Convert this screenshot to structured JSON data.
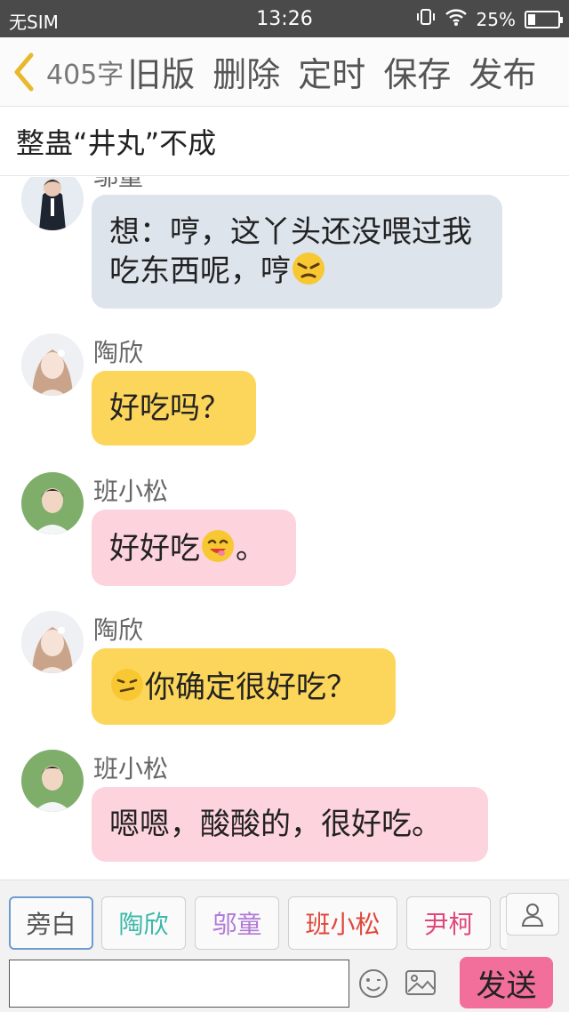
{
  "status_bar": {
    "carrier": "无SIM",
    "time": "13:26",
    "battery_text": "25%",
    "battery_level": 0.25
  },
  "toolbar": {
    "word_count": "405字",
    "buttons": [
      "旧版",
      "删除",
      "定时",
      "保存",
      "发布"
    ]
  },
  "story": {
    "title": "整蛊“井丸”不成"
  },
  "messages": [
    {
      "speaker": "邬童",
      "text": "想：哼，这丫头还没喂过我吃东西呢，哼",
      "emoji": "angry-face",
      "color": "gray"
    },
    {
      "speaker": "陶欣",
      "text": "好吃吗？",
      "color": "yellow"
    },
    {
      "speaker": "班小松",
      "text_before": "好好吃",
      "emoji": "yum-face",
      "text_after": "。",
      "color": "pink"
    },
    {
      "speaker": "陶欣",
      "emoji": "confused-face",
      "text": "你确定很好吃？",
      "color": "yellow"
    },
    {
      "speaker": "班小松",
      "text": "嗯嗯，酸酸的，很好吃。",
      "color": "pink"
    }
  ],
  "characters": [
    {
      "name": "旁白",
      "color": "#555555",
      "selected": true
    },
    {
      "name": "陶欣",
      "color": "#3bb8a8"
    },
    {
      "name": "邬童",
      "color": "#b07ad8"
    },
    {
      "name": "班小松",
      "color": "#e0483c"
    },
    {
      "name": "尹柯",
      "color": "#e0487a"
    }
  ],
  "input": {
    "placeholder": "",
    "value": "",
    "send_label": "发送"
  },
  "colors": {
    "status_bar": "#4a4a4a",
    "bubble_gray": "#dde4ec",
    "bubble_yellow": "#fcd65a",
    "bubble_pink": "#fdd3dd",
    "send_button": "#f26f9c",
    "back_arrow": "#e8b92c"
  }
}
